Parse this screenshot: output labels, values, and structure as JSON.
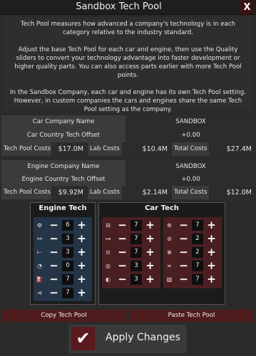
{
  "window": {
    "title": "Sandbox Tech Pool",
    "close_label": "X"
  },
  "description": [
    "Tech Pool measures how advanced a company's technology is in each category relative to the industry standard.",
    "Adjust the base Tech Pool for each car and engine, then use the Quality sliders to convert your technology advantage into faster development or higher quality parts. You can also access parts earlier with more Tech Pool points.",
    "In the Sandbox Company, each car and engine has its own Tech Pool setting. However, in custom companies the cars and engines share the same Tech Pool setting as the company."
  ],
  "car_company": {
    "name_label": "Car Company Name",
    "name_value": "SANDBOX",
    "offset_label": "Car Country Tech Offset",
    "offset_value": "+0.00",
    "tech_pool_costs_label": "Tech Pool Costs",
    "tech_pool_costs_value": "$17.0M",
    "lab_costs_label": "Lab Costs",
    "lab_costs_value": "$10.4M",
    "total_costs_label": "Total Costs",
    "total_costs_value": "$27.4M"
  },
  "engine_company": {
    "name_label": "Engine Company Name",
    "name_value": "SANDBOX",
    "offset_label": "Engine Country Tech Offset",
    "offset_value": "+0.00",
    "tech_pool_costs_label": "Tech Pool Costs",
    "tech_pool_costs_value": "$9.92M",
    "lab_costs_label": "Lab Costs",
    "lab_costs_value": "$2.14M",
    "total_costs_label": "Total Costs",
    "total_costs_value": "$12.0M"
  },
  "engine_tech": {
    "title": "Engine Tech",
    "rows": [
      {
        "icon": "engine-block-icon",
        "glyph": "⚙",
        "value": "6"
      },
      {
        "icon": "crankshaft-icon",
        "glyph": "⚯",
        "value": "3"
      },
      {
        "icon": "head-icon",
        "glyph": "⊢",
        "value": "3"
      },
      {
        "icon": "turbo-icon",
        "glyph": "◔",
        "value": "0"
      },
      {
        "icon": "fuel-system-icon",
        "glyph": "⛽",
        "value": "7"
      },
      {
        "icon": "exhaust-icon",
        "glyph": "⊲",
        "value": "7"
      }
    ]
  },
  "car_tech": {
    "title": "Car Tech",
    "left_rows": [
      {
        "icon": "chassis-icon",
        "glyph": "⊟",
        "value": "7"
      },
      {
        "icon": "car-body-icon",
        "glyph": "⊶",
        "value": "7"
      },
      {
        "icon": "drivetrain-icon",
        "glyph": "⊙",
        "value": "7"
      },
      {
        "icon": "suspension-icon",
        "glyph": "◎",
        "value": "3"
      },
      {
        "icon": "safety-icon",
        "glyph": "◐",
        "value": "3"
      }
    ],
    "right_rows": [
      {
        "icon": "tyres-icon",
        "glyph": "⊛",
        "value": "7"
      },
      {
        "icon": "brakes-icon",
        "glyph": "⊘",
        "value": "2"
      },
      {
        "icon": "wheel-icon",
        "glyph": "⊗",
        "value": "2"
      },
      {
        "icon": "aero-icon",
        "glyph": "≈",
        "value": "7"
      },
      {
        "icon": "interior-icon",
        "glyph": "▥",
        "value": "7"
      }
    ]
  },
  "buttons": {
    "copy": "Copy Tech Pool",
    "paste": "Paste Tech Pool",
    "apply": "Apply Changes",
    "apply_glyph": "✔",
    "minus": "−",
    "plus": "+"
  }
}
